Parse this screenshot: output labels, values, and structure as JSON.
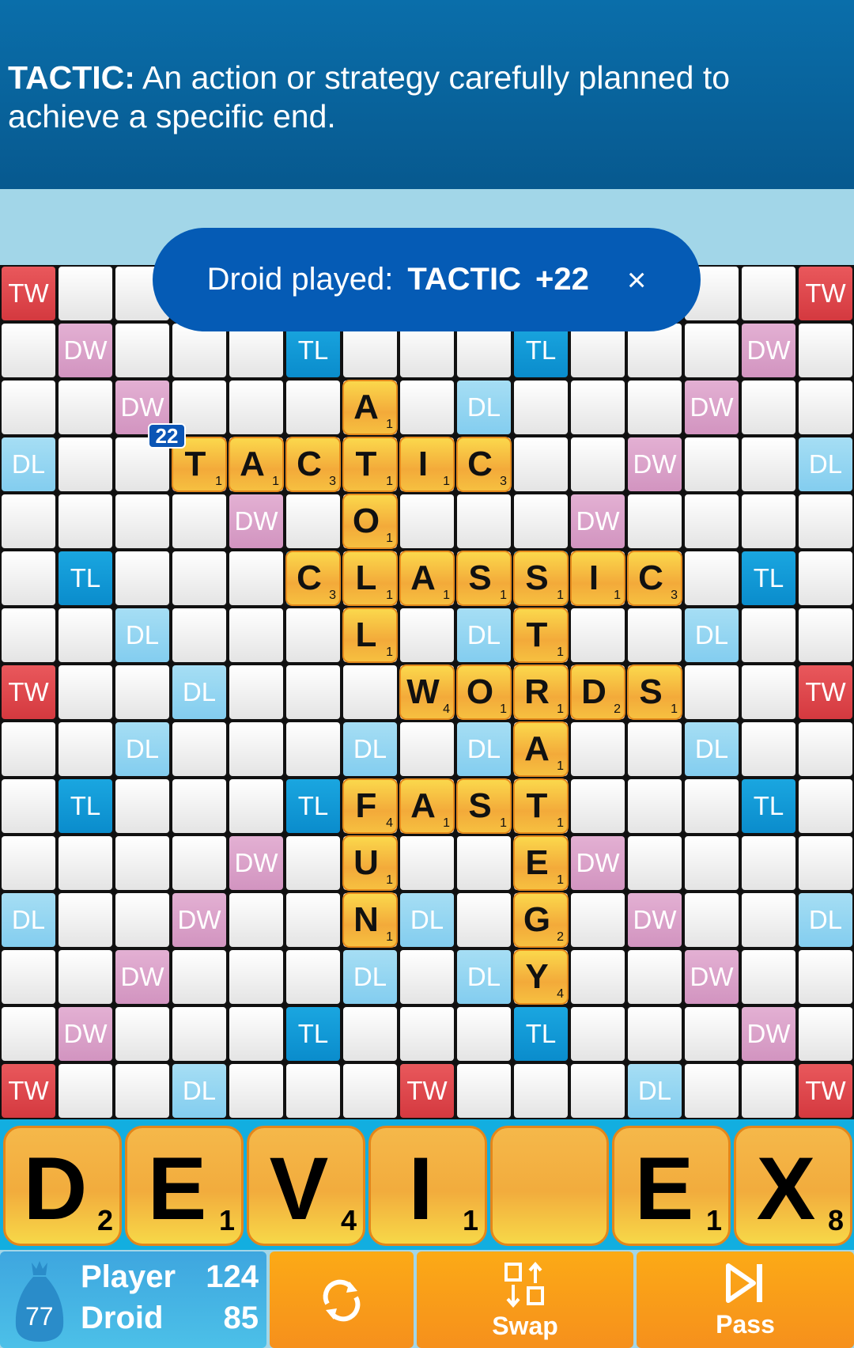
{
  "definition": {
    "word": "TACTIC:",
    "text": " An action or strategy carefully planned to achieve a specific end."
  },
  "toast": {
    "prefix": "Droid played:",
    "word": "TACTIC",
    "points": "+22",
    "close": "×"
  },
  "last_move_badge": "22",
  "colors": {
    "TW": "#e04a4f",
    "DW": "#d99cc5",
    "TL": "#0a9ad8",
    "DL": "#8fd3ef",
    "tile": "#f5b845",
    "header": "#0a6eaa"
  },
  "board": {
    "premium_rows": [
      [
        "TW",
        "",
        "",
        "DL",
        "",
        "",
        "",
        "TW",
        "",
        "",
        "",
        "DL",
        "",
        "",
        "TW"
      ],
      [
        "",
        "DW",
        "",
        "",
        "",
        "TL",
        "",
        "",
        "",
        "TL",
        "",
        "",
        "",
        "DW",
        ""
      ],
      [
        "",
        "",
        "DW",
        "",
        "",
        "",
        "",
        "",
        "DL",
        "",
        "",
        "",
        "DW",
        "",
        ""
      ],
      [
        "DL",
        "",
        "",
        "DW",
        "",
        "",
        "",
        "",
        "",
        "",
        "",
        "DW",
        "",
        "",
        "DL"
      ],
      [
        "",
        "",
        "",
        "",
        "DW",
        "",
        "",
        "",
        "",
        "",
        "DW",
        "",
        "",
        "",
        ""
      ],
      [
        "",
        "TL",
        "",
        "",
        "",
        "TL",
        "",
        "",
        "",
        "TL",
        "",
        "",
        "",
        "TL",
        ""
      ],
      [
        "",
        "",
        "DL",
        "",
        "",
        "",
        "",
        "",
        "DL",
        "",
        "",
        "",
        "DL",
        "",
        ""
      ],
      [
        "TW",
        "",
        "",
        "DL",
        "",
        "",
        "",
        "",
        "",
        "",
        "",
        "",
        "",
        "",
        "TW"
      ],
      [
        "",
        "",
        "DL",
        "",
        "",
        "",
        "DL",
        "",
        "DL",
        "",
        "",
        "",
        "DL",
        "",
        ""
      ],
      [
        "",
        "TL",
        "",
        "",
        "",
        "TL",
        "",
        "",
        "",
        "",
        "",
        "",
        "",
        "TL",
        ""
      ],
      [
        "",
        "",
        "",
        "",
        "DW",
        "",
        "",
        "",
        "",
        "",
        "DW",
        "",
        "",
        "",
        ""
      ],
      [
        "DL",
        "",
        "",
        "DW",
        "",
        "",
        "",
        "DL",
        "",
        "",
        "",
        "DW",
        "",
        "",
        "DL"
      ],
      [
        "",
        "",
        "DW",
        "",
        "",
        "",
        "DL",
        "",
        "DL",
        "",
        "",
        "",
        "DW",
        "",
        ""
      ],
      [
        "",
        "DW",
        "",
        "",
        "",
        "TL",
        "",
        "",
        "",
        "TL",
        "",
        "",
        "",
        "DW",
        ""
      ],
      [
        "TW",
        "",
        "",
        "DL",
        "",
        "",
        "",
        "TW",
        "",
        "",
        "",
        "DL",
        "",
        "",
        "TW"
      ]
    ],
    "tiles": [
      {
        "row": 2,
        "col": 6,
        "letter": "A",
        "value": 1
      },
      {
        "row": 3,
        "col": 3,
        "letter": "T",
        "value": 1
      },
      {
        "row": 3,
        "col": 4,
        "letter": "A",
        "value": 1
      },
      {
        "row": 3,
        "col": 5,
        "letter": "C",
        "value": 3
      },
      {
        "row": 3,
        "col": 6,
        "letter": "T",
        "value": 1
      },
      {
        "row": 3,
        "col": 7,
        "letter": "I",
        "value": 1
      },
      {
        "row": 3,
        "col": 8,
        "letter": "C",
        "value": 3
      },
      {
        "row": 4,
        "col": 6,
        "letter": "O",
        "value": 1
      },
      {
        "row": 5,
        "col": 5,
        "letter": "C",
        "value": 3
      },
      {
        "row": 5,
        "col": 6,
        "letter": "L",
        "value": 1
      },
      {
        "row": 5,
        "col": 7,
        "letter": "A",
        "value": 1
      },
      {
        "row": 5,
        "col": 8,
        "letter": "S",
        "value": 1
      },
      {
        "row": 5,
        "col": 9,
        "letter": "S",
        "value": 1
      },
      {
        "row": 5,
        "col": 10,
        "letter": "I",
        "value": 1
      },
      {
        "row": 5,
        "col": 11,
        "letter": "C",
        "value": 3
      },
      {
        "row": 6,
        "col": 6,
        "letter": "L",
        "value": 1
      },
      {
        "row": 6,
        "col": 9,
        "letter": "T",
        "value": 1
      },
      {
        "row": 7,
        "col": 7,
        "letter": "W",
        "value": 4
      },
      {
        "row": 7,
        "col": 8,
        "letter": "O",
        "value": 1
      },
      {
        "row": 7,
        "col": 9,
        "letter": "R",
        "value": 1
      },
      {
        "row": 7,
        "col": 10,
        "letter": "D",
        "value": 2
      },
      {
        "row": 7,
        "col": 11,
        "letter": "S",
        "value": 1
      },
      {
        "row": 8,
        "col": 9,
        "letter": "A",
        "value": 1
      },
      {
        "row": 9,
        "col": 6,
        "letter": "F",
        "value": 4
      },
      {
        "row": 9,
        "col": 7,
        "letter": "A",
        "value": 1
      },
      {
        "row": 9,
        "col": 8,
        "letter": "S",
        "value": 1
      },
      {
        "row": 9,
        "col": 9,
        "letter": "T",
        "value": 1
      },
      {
        "row": 10,
        "col": 6,
        "letter": "U",
        "value": 1
      },
      {
        "row": 10,
        "col": 9,
        "letter": "E",
        "value": 1
      },
      {
        "row": 11,
        "col": 6,
        "letter": "N",
        "value": 1
      },
      {
        "row": 11,
        "col": 9,
        "letter": "G",
        "value": 2
      },
      {
        "row": 12,
        "col": 9,
        "letter": "Y",
        "value": 4
      }
    ]
  },
  "rack": [
    {
      "letter": "D",
      "value": "2"
    },
    {
      "letter": "E",
      "value": "1"
    },
    {
      "letter": "V",
      "value": "4"
    },
    {
      "letter": "I",
      "value": "1"
    },
    {
      "letter": "",
      "value": ""
    },
    {
      "letter": "E",
      "value": "1"
    },
    {
      "letter": "X",
      "value": "8"
    }
  ],
  "scores": {
    "bag_count": "77",
    "player_label": "Player",
    "player_score": "124",
    "droid_label": "Droid",
    "droid_score": "85"
  },
  "buttons": {
    "shuffle_icon": "refresh-icon",
    "swap": "Swap",
    "pass": "Pass"
  }
}
